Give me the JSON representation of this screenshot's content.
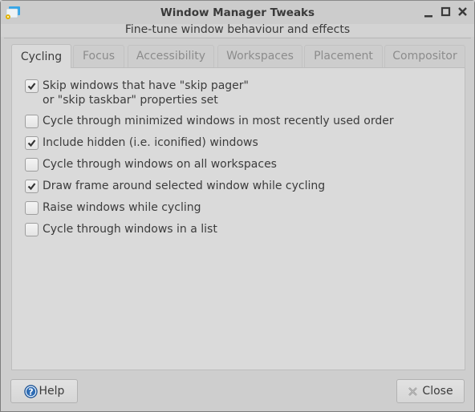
{
  "window": {
    "title": "Window Manager Tweaks",
    "subtitle": "Fine-tune window behaviour and effects",
    "icon": "window-manager-tweaks-icon",
    "controls": [
      "minimize-icon",
      "maximize-icon",
      "close-icon"
    ]
  },
  "tabs": [
    {
      "label": "Cycling",
      "active": true
    },
    {
      "label": "Focus",
      "active": false
    },
    {
      "label": "Accessibility",
      "active": false
    },
    {
      "label": "Workspaces",
      "active": false
    },
    {
      "label": "Placement",
      "active": false
    },
    {
      "label": "Compositor",
      "active": false
    }
  ],
  "options": [
    {
      "label": "Skip windows that have \"skip pager\"\nor \"skip taskbar\" properties set",
      "checked": true
    },
    {
      "label": "Cycle through minimized windows in most recently used order",
      "checked": false
    },
    {
      "label": "Include hidden (i.e. iconified) windows",
      "checked": true
    },
    {
      "label": "Cycle through windows on all workspaces",
      "checked": false
    },
    {
      "label": "Draw frame around selected window while cycling",
      "checked": true
    },
    {
      "label": "Raise windows while cycling",
      "checked": false
    },
    {
      "label": "Cycle through windows in a list",
      "checked": false
    }
  ],
  "buttons": {
    "help": {
      "label": "Help",
      "icon": "help-icon"
    },
    "close": {
      "label": "Close",
      "icon": "close-icon"
    }
  },
  "colors": {
    "help_icon": "#2f6db5",
    "app_icon_blue": "#35a6e8",
    "app_icon_gear": "#e0b000"
  }
}
